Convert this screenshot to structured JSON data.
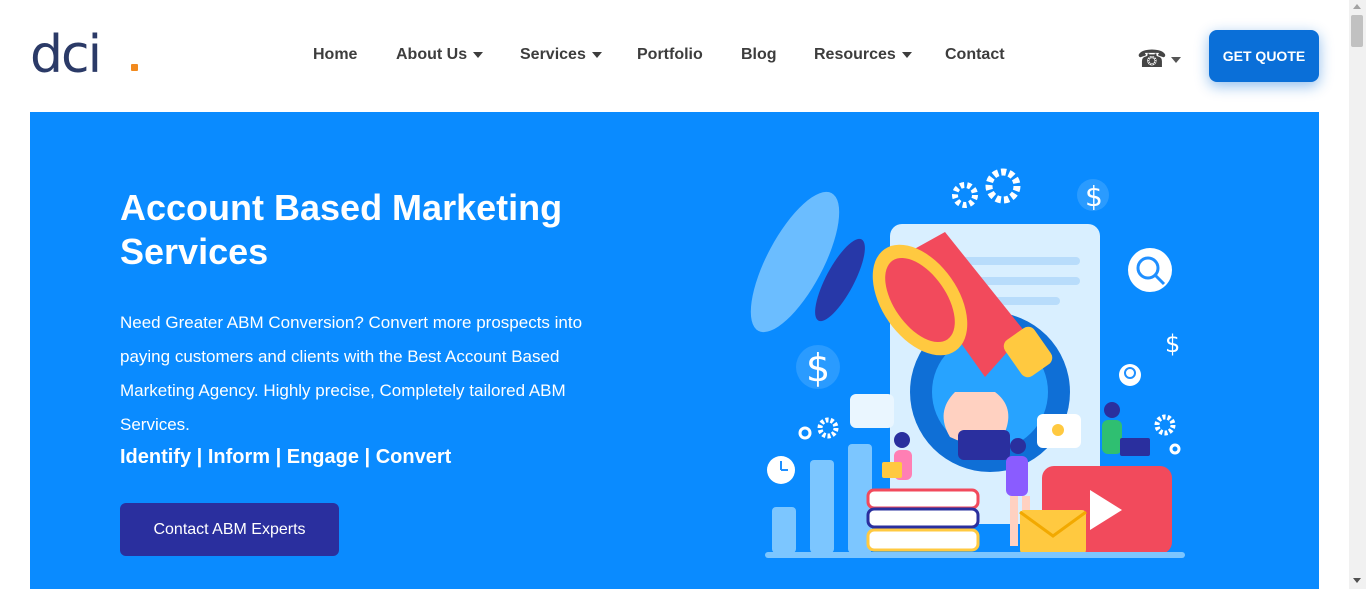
{
  "brand": {
    "logo_text": "dci",
    "accent_color": "#f28a1e",
    "logo_color": "#2b3a67"
  },
  "nav": {
    "items": [
      {
        "label": "Home",
        "has_dropdown": false
      },
      {
        "label": "About Us",
        "has_dropdown": true
      },
      {
        "label": "Services",
        "has_dropdown": true
      },
      {
        "label": "Portfolio",
        "has_dropdown": false
      },
      {
        "label": "Blog",
        "has_dropdown": false
      },
      {
        "label": "Resources",
        "has_dropdown": true
      },
      {
        "label": "Contact",
        "has_dropdown": false
      }
    ],
    "phone_icon": "☎",
    "cta_label": "GET QUOTE",
    "cta_color": "#0a6fd8"
  },
  "hero": {
    "title": "Account Based Marketing Services",
    "description": "Need Greater ABM Conversion? Convert more prospects into paying customers and clients with the Best Account Based Marketing Agency. Highly precise, Completely tailored ABM Services.",
    "tagline": "Identify | Inform | Engage | Convert",
    "button_label": "Contact ABM Experts",
    "background_color": "#0a8bff",
    "button_color": "#2a2f9e",
    "illustration_icons": [
      "megaphone-icon",
      "gear-icon",
      "dollar-icon",
      "search-icon",
      "play-icon",
      "envelope-icon",
      "clock-icon",
      "lightbulb-icon"
    ]
  }
}
